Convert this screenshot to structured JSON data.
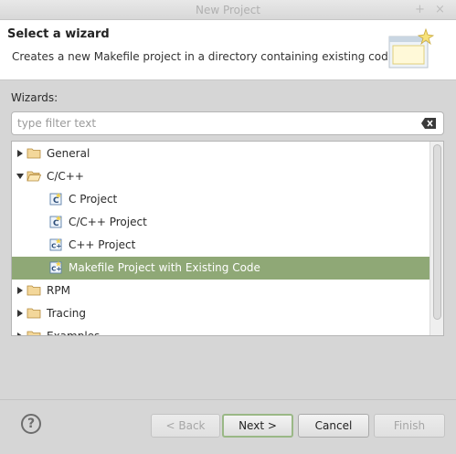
{
  "window": {
    "title": "New Project"
  },
  "header": {
    "title": "Select a wizard",
    "description": "Creates a new Makefile project in a directory containing existing code"
  },
  "wizards_label": "Wizards:",
  "filter": {
    "placeholder": "type filter text",
    "value": ""
  },
  "tree": {
    "items": [
      {
        "label": "General",
        "icon": "folder-icon",
        "level": 0,
        "expanded": false
      },
      {
        "label": "C/C++",
        "icon": "folder-open-icon",
        "level": 0,
        "expanded": true
      },
      {
        "label": "C Project",
        "icon": "c-project-icon",
        "level": 1
      },
      {
        "label": "C/C++ Project",
        "icon": "c-project-icon",
        "level": 1
      },
      {
        "label": "C++ Project",
        "icon": "cpp-project-icon",
        "level": 1
      },
      {
        "label": "Makefile Project with Existing Code",
        "icon": "cpp-project-icon",
        "level": 1,
        "selected": true
      },
      {
        "label": "RPM",
        "icon": "folder-icon",
        "level": 0,
        "expanded": false
      },
      {
        "label": "Tracing",
        "icon": "folder-icon",
        "level": 0,
        "expanded": false
      },
      {
        "label": "Examples",
        "icon": "folder-icon",
        "level": 0,
        "expanded": false
      }
    ]
  },
  "buttons": {
    "back": "< Back",
    "next": "Next >",
    "cancel": "Cancel",
    "finish": "Finish"
  },
  "colors": {
    "selection": "#8fa876",
    "default_border": "#9ab886"
  }
}
